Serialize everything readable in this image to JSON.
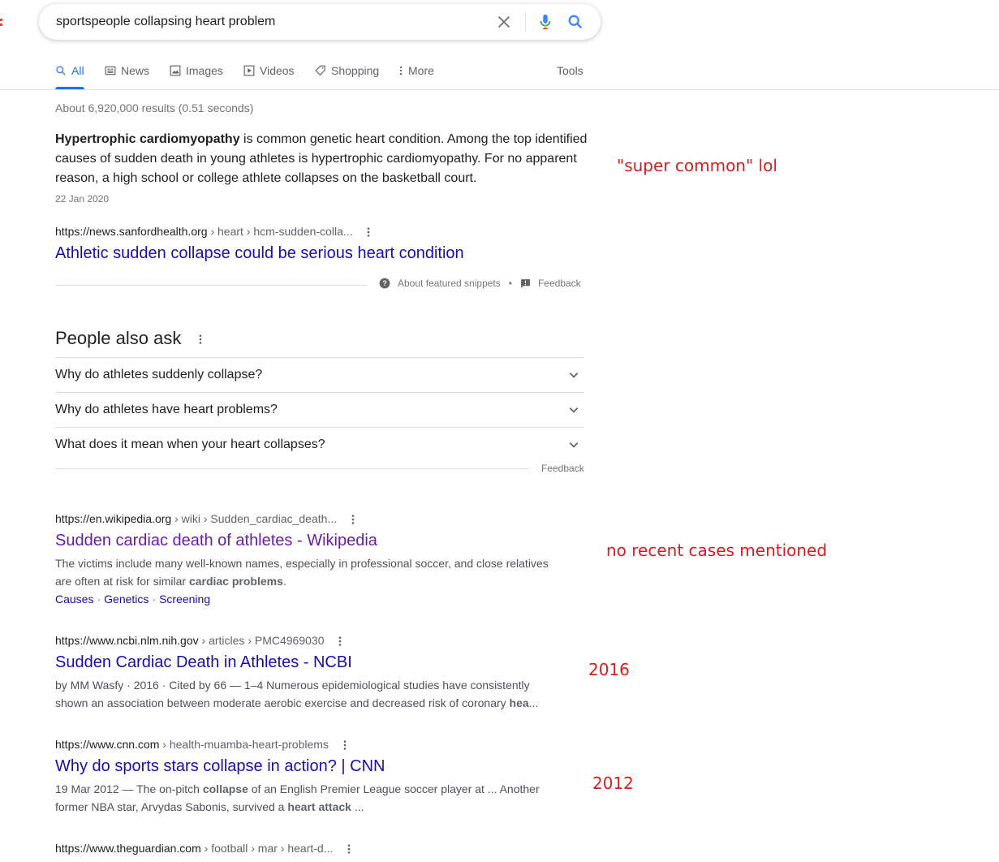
{
  "search": {
    "query": "sportspeople collapsing heart problem",
    "clear_icon": "close-icon",
    "mic_icon": "microphone-icon",
    "search_icon": "search-icon"
  },
  "tabs": [
    {
      "label": "All",
      "icon": "search-icon",
      "active": true
    },
    {
      "label": "News",
      "icon": "newspaper-icon"
    },
    {
      "label": "Images",
      "icon": "image-icon"
    },
    {
      "label": "Videos",
      "icon": "video-icon"
    },
    {
      "label": "Shopping",
      "icon": "tag-icon"
    },
    {
      "label": "More",
      "icon": "dots-vertical-icon"
    }
  ],
  "tools_label": "Tools",
  "result_stats": "About 6,920,000 results (0.51 seconds)",
  "featured_snippet": {
    "bold": "Hypertrophic cardiomyopathy",
    "text": " is common genetic heart condition. Among the top identified causes of sudden death in young athletes is hypertrophic cardiomyopathy. For no apparent reason, a high school or college athlete collapses on the basketball court.",
    "date": "22 Jan 2020",
    "cite_domain": "https://news.sanfordhealth.org",
    "cite_path": " › heart › hcm-sudden-colla...",
    "title": "Athletic sudden collapse could be serious heart condition",
    "footer_about": "About featured snippets",
    "footer_dot": "•",
    "footer_feedback": "Feedback"
  },
  "people_also_ask": {
    "title": "People also ask",
    "questions": [
      "Why do athletes suddenly collapse?",
      "Why do athletes have heart problems?",
      "What does it mean when your heart collapses?"
    ],
    "feedback": "Feedback"
  },
  "results": [
    {
      "cite_domain": "https://en.wikipedia.org",
      "cite_path": " › wiki › Sudden_cardiac_death...",
      "title": "Sudden cardiac death of athletes - Wikipedia",
      "desc_1": "The victims include many well-known names, especially in professional soccer, and close relatives are often at risk for similar ",
      "desc_bold_1": "cardiac problems",
      "desc_2": ".",
      "sitelinks": [
        "Causes",
        "Genetics",
        "Screening"
      ],
      "sitelink_sep": "·"
    },
    {
      "cite_domain": "https://www.ncbi.nlm.nih.gov",
      "cite_path": " › articles › PMC4969030",
      "title": "Sudden Cardiac Death in Athletes - NCBI",
      "desc_1": "by MM Wasfy · 2016 · Cited by 66 — 1–4 Numerous epidemiological studies have consistently shown an association between moderate aerobic exercise and decreased risk of coronary ",
      "desc_bold_1": "hea",
      "desc_2": "..."
    },
    {
      "cite_domain": "https://www.cnn.com",
      "cite_path": " › health-muamba-heart-problems",
      "title": "Why do sports stars collapse in action? | CNN",
      "desc_1": "19 Mar 2012 — The on-pitch ",
      "desc_bold_1": "collapse",
      "desc_2": " of an English Premier League soccer player at ... Another former NBA star, Arvydas Sabonis, survived a ",
      "desc_bold_2": "heart attack",
      "desc_3": " ..."
    },
    {
      "cite_domain": "https://www.theguardian.com",
      "cite_path": " › football › mar › heart-d..."
    }
  ],
  "annotations": {
    "note_1": "\"super common\" lol",
    "note_2": "no recent cases mentioned",
    "note_3": "2016",
    "note_4": "2012",
    "color": "#d21f1f"
  },
  "colors": {
    "link": "#1a0dab",
    "visited": "#681da8",
    "active_tab": "#1a73e8"
  }
}
